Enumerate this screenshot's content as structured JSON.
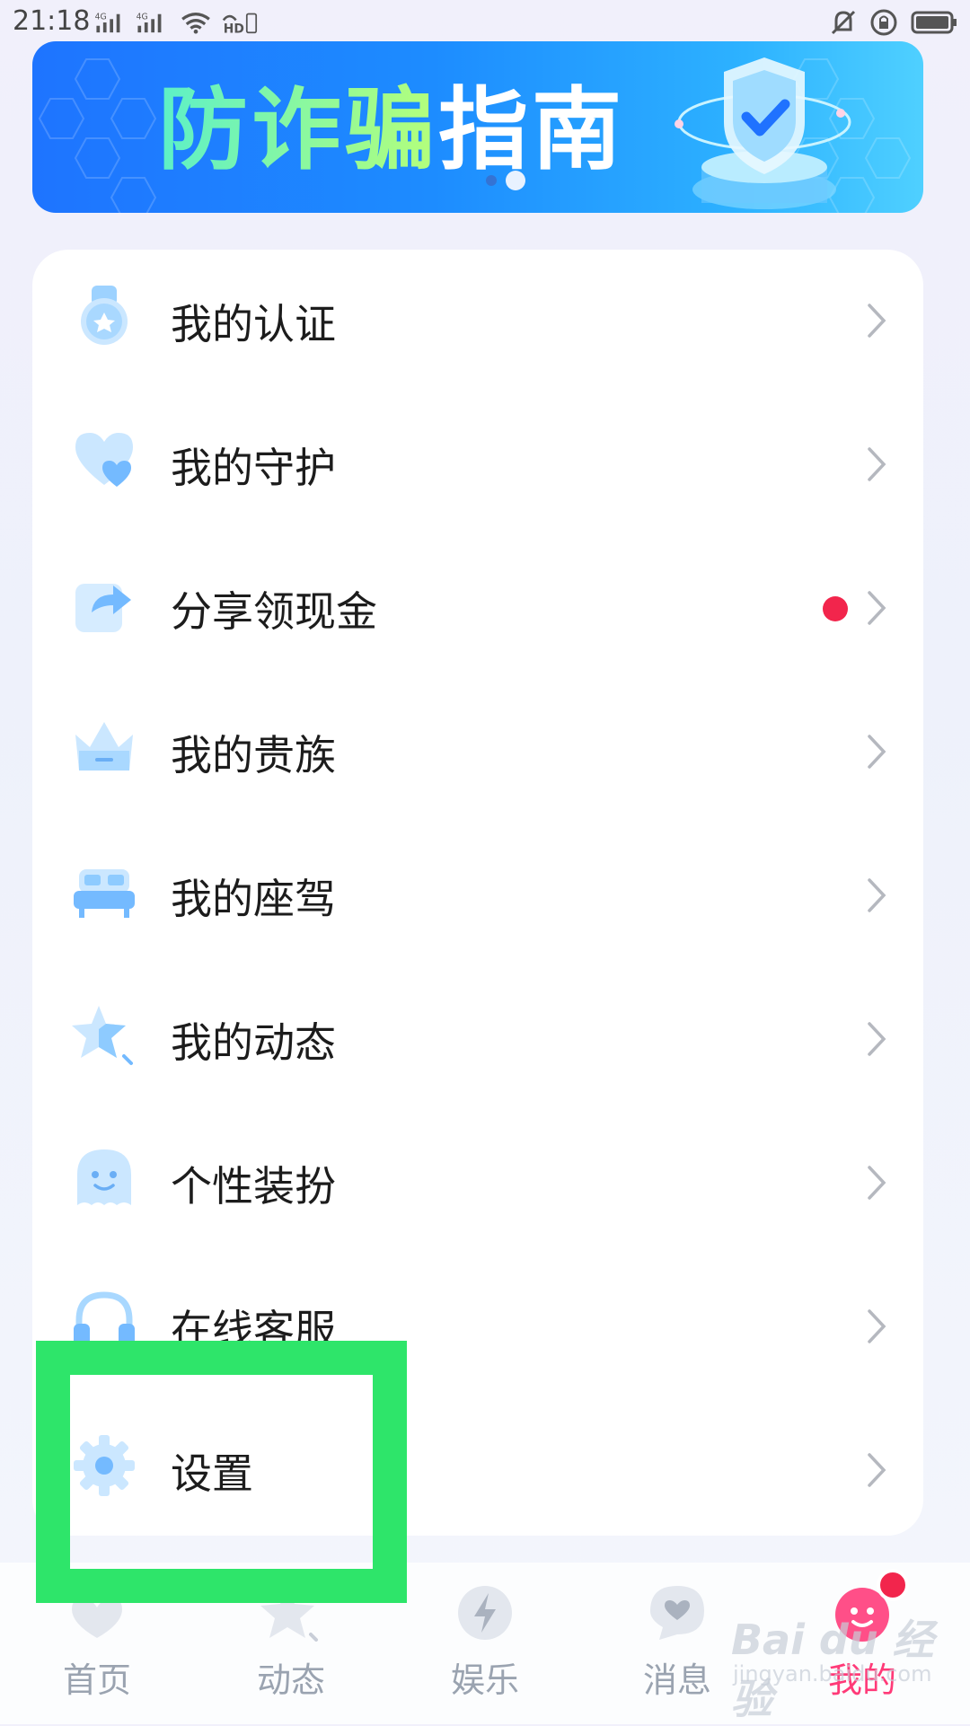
{
  "status_bar": {
    "time": "21:18",
    "network_1": "4G",
    "network_2": "4G",
    "hd_label": "HD"
  },
  "banner": {
    "title_part1": "防诈骗",
    "title_part2": "指南",
    "page_count": 2,
    "active_page": 2
  },
  "menu": {
    "items": [
      {
        "label": "我的认证",
        "icon": "certification-icon",
        "has_badge": false
      },
      {
        "label": "我的守护",
        "icon": "heart-icon",
        "has_badge": false
      },
      {
        "label": "分享领现金",
        "icon": "share-icon",
        "has_badge": true
      },
      {
        "label": "我的贵族",
        "icon": "crown-icon",
        "has_badge": false
      },
      {
        "label": "我的座驾",
        "icon": "vehicle-icon",
        "has_badge": false
      },
      {
        "label": "我的动态",
        "icon": "star-icon",
        "has_badge": false
      },
      {
        "label": "个性装扮",
        "icon": "ghost-icon",
        "has_badge": false
      },
      {
        "label": "在线客服",
        "icon": "headset-icon",
        "has_badge": false
      },
      {
        "label": "设置",
        "icon": "gear-icon",
        "has_badge": false
      }
    ]
  },
  "tab_bar": {
    "tabs": [
      {
        "label": "首页",
        "icon": "home-icon"
      },
      {
        "label": "动态",
        "icon": "feed-icon"
      },
      {
        "label": "娱乐",
        "icon": "lightning-icon"
      },
      {
        "label": "消息",
        "icon": "message-icon"
      },
      {
        "label": "我的",
        "icon": "profile-icon"
      }
    ],
    "active_tab": "我的"
  },
  "colors": {
    "accent_pink": "#ff3a78",
    "badge_red": "#f2254c",
    "highlight_green": "#2ee56a",
    "icon_blue": "#8ecbff"
  },
  "watermark": {
    "text": "Bai du 经验",
    "sub": "jingyan.baidu.com"
  }
}
